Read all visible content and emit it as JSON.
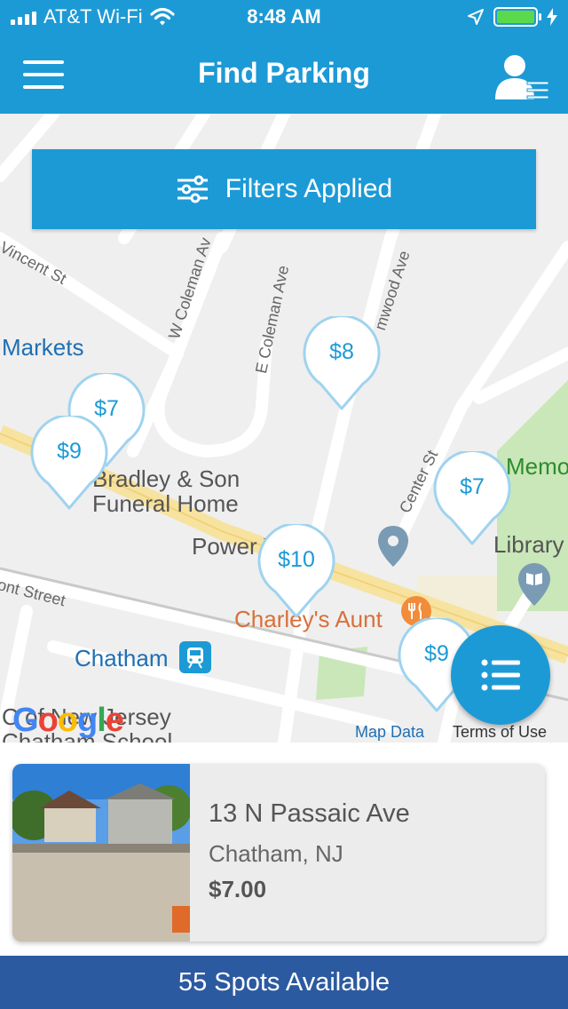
{
  "status_bar": {
    "carrier": "AT&T Wi-Fi",
    "time": "8:48 AM"
  },
  "header": {
    "title": "Find Parking",
    "menu_icon": "hamburger-icon",
    "profile_icon": "user-list-icon"
  },
  "map": {
    "filters_label": "Filters Applied",
    "filters_icon": "sliders-icon",
    "street_labels": {
      "vincent": "Vincent St",
      "w_coleman": "W Coleman Av",
      "e_coleman": "E Coleman Ave",
      "elmwood": "mwood Ave",
      "center": "Center St",
      "front": "ont Street"
    },
    "places": {
      "markets": "Markets",
      "funeral_1": "Bradley & Son",
      "funeral_2": "Funeral Home",
      "yoga": "Power Yoga",
      "restaurant": "Charley's Aunt",
      "station": "Chatham",
      "memorial": "Memo",
      "library": "Library",
      "school_1": "C of New Jersey",
      "school_2": "Chatham School"
    },
    "pins": [
      "$8",
      "$7",
      "$9",
      "$7",
      "$10",
      "$9"
    ],
    "google_logo": "Google",
    "map_data": "Map Data",
    "terms": "Terms of Use",
    "fab_icon": "list-icon"
  },
  "listing": {
    "address": "13 N Passaic Ave",
    "city": "Chatham, NJ",
    "price": "$7.00"
  },
  "footer": {
    "spots": "55 Spots Available"
  },
  "colors": {
    "brand_blue": "#1c9ad6",
    "footer_blue": "#2c5aa0",
    "battery_green": "#5cd94a"
  }
}
